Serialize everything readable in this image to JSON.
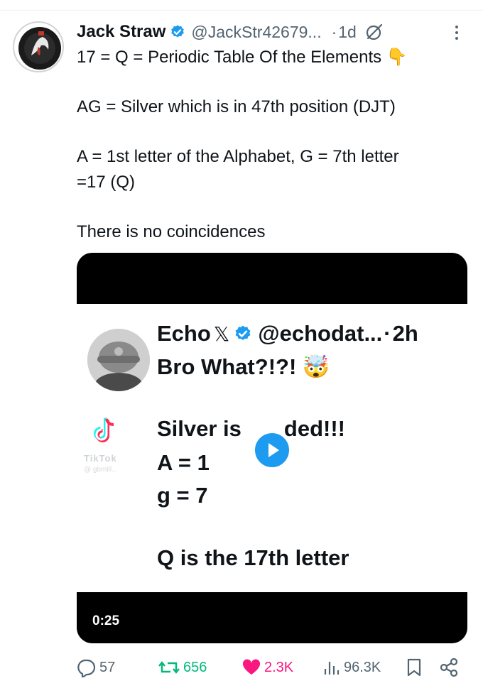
{
  "tweet": {
    "author_name": "Jack Straw",
    "author_handle": "@JackStr42679...",
    "separator": "·",
    "time": "1d",
    "text_lines": [
      "17 = Q  = Periodic Table Of the Elements 👇",
      "AG = Silver which is in 47th position (DJT)",
      "A = 1st letter of the Alphabet,  G = 7th letter",
      "=17 (Q)",
      "There is no coincidences"
    ]
  },
  "video": {
    "quoted": {
      "name": "Echo",
      "x_glyph": "𝕏",
      "handle": "@echodat...",
      "separator": "·",
      "time": "2h",
      "line1": "Bro What?!?! 🤯",
      "line2": "Silver is ●●●ded!!!",
      "line2_visible": "Silver is",
      "line2_tail": "ded!!!",
      "line3": "A = 1",
      "line4": "g = 7",
      "line5": "Q is the 17th letter",
      "watermark": "TikTok",
      "watermark_sub": "@ gbmill..."
    },
    "duration": "0:25"
  },
  "actions": {
    "replies": "57",
    "reposts": "656",
    "likes": "2.3K",
    "views": "96.3K"
  },
  "colors": {
    "text": "#0f1419",
    "secondary": "#536471",
    "verified": "#1d9bf0",
    "repost_active": "#00ba7c",
    "like_active": "#f91880",
    "play_button": "#1d9bf0"
  },
  "icons": {
    "verified": "verified-badge-icon",
    "grok": "grok-icon",
    "more": "more-vertical-icon",
    "reply": "reply-icon",
    "repost": "repost-icon",
    "like": "heart-icon",
    "views": "views-icon",
    "bookmark": "bookmark-icon",
    "share": "share-icon",
    "play": "play-icon",
    "tiktok": "tiktok-icon"
  }
}
